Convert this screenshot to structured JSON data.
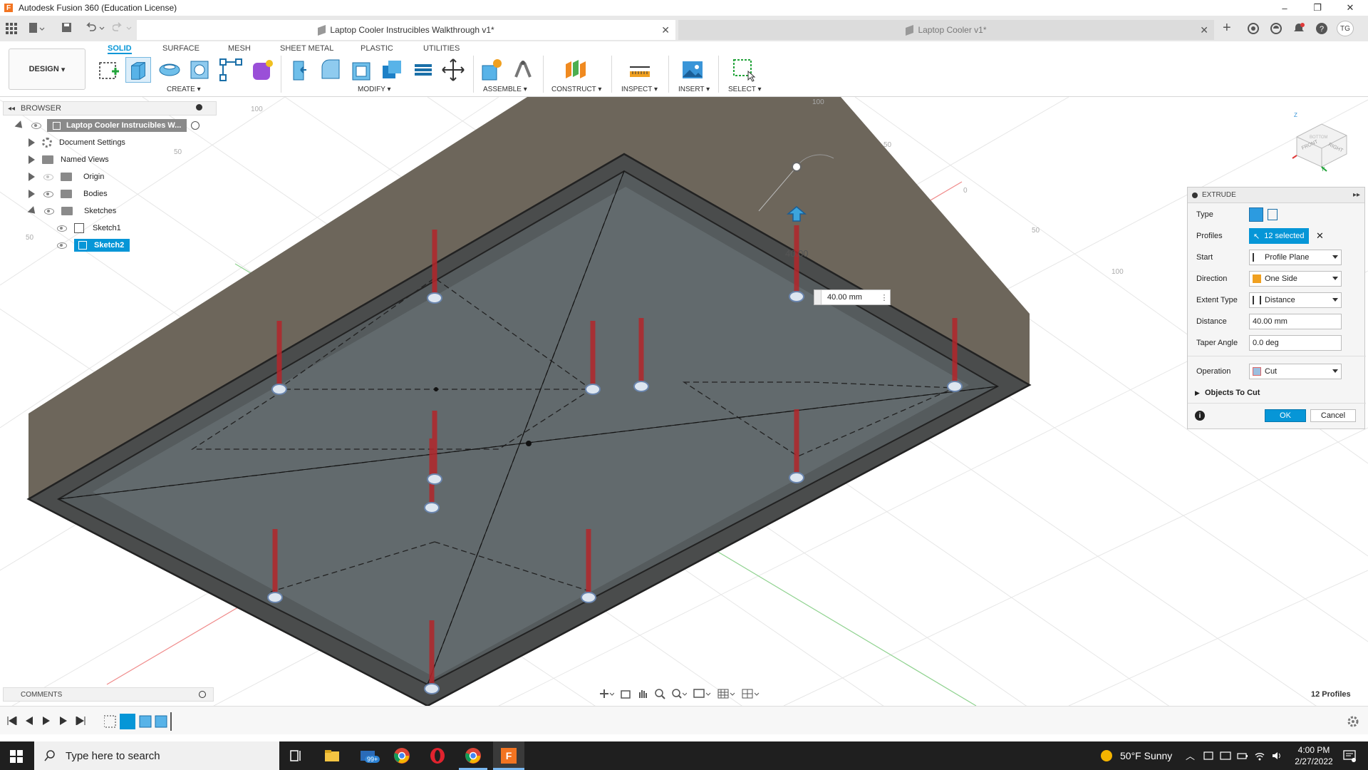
{
  "window": {
    "title": "Autodesk Fusion 360 (Education License)",
    "logo_letter": "F",
    "minimize": "–",
    "maximize": "❐",
    "close": "✕"
  },
  "tabs": [
    {
      "label": "Laptop Cooler Instrucibles Walkthrough v1*",
      "active": true
    },
    {
      "label": "Laptop Cooler v1*",
      "active": false
    }
  ],
  "user_initials": "TG",
  "toolbar": {
    "workspace": "DESIGN",
    "tabs": [
      "SOLID",
      "SURFACE",
      "MESH",
      "SHEET METAL",
      "PLASTIC",
      "UTILITIES"
    ],
    "groups": [
      "CREATE",
      "MODIFY",
      "ASSEMBLE",
      "CONSTRUCT",
      "INSPECT",
      "INSERT",
      "SELECT"
    ]
  },
  "browser": {
    "header": "BROWSER",
    "root": "Laptop Cooler Instrucibles W...",
    "items": [
      {
        "label": "Document Settings"
      },
      {
        "label": "Named Views"
      },
      {
        "label": "Origin"
      },
      {
        "label": "Bodies"
      },
      {
        "label": "Sketches"
      },
      {
        "label": "Sketch1"
      },
      {
        "label": "Sketch2"
      }
    ]
  },
  "viewport": {
    "dimension_input": "40.00 mm",
    "dimension_ghost": "40.00",
    "profiles_count": "12 Profiles",
    "grid_labels": [
      "100",
      "50",
      "50",
      "0",
      "50",
      "100",
      "100",
      "50"
    ]
  },
  "viewcube": {
    "front": "FRONT",
    "right": "RIGHT",
    "bottom": "BOTTOM",
    "z": "Z",
    "y": "Y"
  },
  "extrude": {
    "title": "EXTRUDE",
    "type_label": "Type",
    "profiles_label": "Profiles",
    "profiles_value": "12 selected",
    "start_label": "Start",
    "start_value": "Profile Plane",
    "direction_label": "Direction",
    "direction_value": "One Side",
    "extent_label": "Extent Type",
    "extent_value": "Distance",
    "distance_label": "Distance",
    "distance_value": "40.00 mm",
    "taper_label": "Taper Angle",
    "taper_value": "0.0 deg",
    "operation_label": "Operation",
    "operation_value": "Cut",
    "objects_label": "Objects To Cut",
    "ok": "OK",
    "cancel": "Cancel",
    "info": "i"
  },
  "comments": {
    "label": "COMMENTS"
  },
  "taskbar": {
    "search_placeholder": "Type here to search",
    "mail_badge": "99+",
    "weather": "50°F  Sunny",
    "time": "4:00 PM",
    "date": "2/27/2022"
  }
}
